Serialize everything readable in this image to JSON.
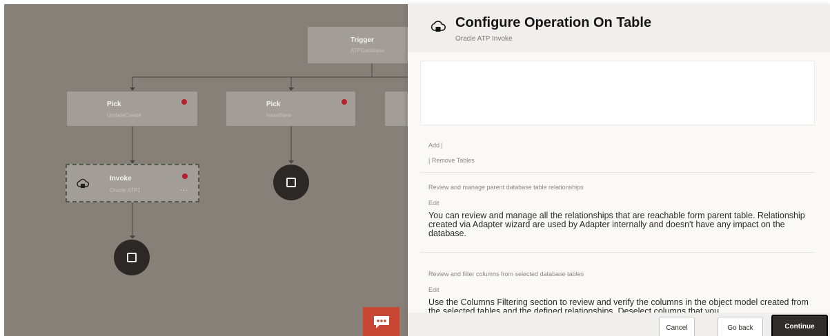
{
  "canvas": {
    "trigger": {
      "title": "Trigger",
      "subtitle": "ATPDatabase"
    },
    "pick1": {
      "title": "Pick",
      "subtitle": "UpdateCreate"
    },
    "pick2": {
      "title": "Pick",
      "subtitle": "InsertNew"
    },
    "invoke": {
      "title": "Invoke",
      "subtitle": "Oracle ATP1",
      "more": "..."
    },
    "colors": {
      "background": "#878079",
      "node": "#a29d97",
      "error_dot": "#b51f2c",
      "chat": "#c74634"
    }
  },
  "drawer": {
    "title": "Configure Operation On Table",
    "subtitle": "Oracle ATP Invoke",
    "add_link": "Add |",
    "remove_link": "| Remove Tables",
    "relationships_heading": "Review and manage parent database table relationships",
    "relationships_edit": "Edit",
    "relationships_text": "You can review and manage all the relationships that are reachable form parent table. Relationship created via Adapter wizard are used by Adapter internally and doesn't have any impact on the database.",
    "columns_heading": "Review and filter columns from selected database tables",
    "columns_edit": "Edit",
    "columns_text": "Use the Columns Filtering section to review and verify the columns in the object model created from the selected tables and the defined relationships. Deselect columns that you"
  },
  "footer": {
    "cancel": "Cancel",
    "go_back": "Go back",
    "continue": "Continue"
  }
}
